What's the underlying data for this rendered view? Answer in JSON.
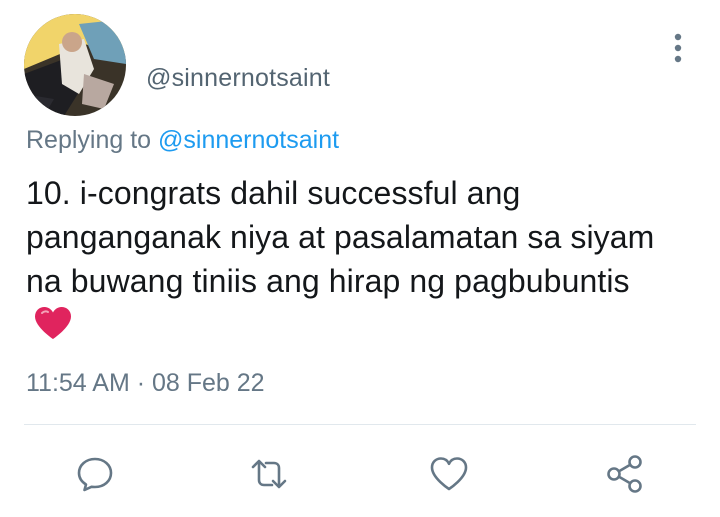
{
  "user": {
    "handle": "@sinnernotsaint"
  },
  "reply": {
    "prefix": "Replying to",
    "mention": "@sinnernotsaint"
  },
  "tweet": {
    "text": "10. i-congrats dahil successful ang panganganak niya at pasalamatan sa siyam na buwang tiniis ang hirap ng pagbubuntis",
    "emoji": "red-heart-emoji",
    "timestamp": "11:54 AM · 08 Feb 22"
  },
  "actions": [
    {
      "name": "reply",
      "icon": "comment-icon"
    },
    {
      "name": "retweet",
      "icon": "retweet-icon"
    },
    {
      "name": "like",
      "icon": "heart-icon"
    },
    {
      "name": "share",
      "icon": "share-icon"
    }
  ],
  "colors": {
    "text": "#14171a",
    "secondary": "#657786",
    "link": "#1d9bf0",
    "heart": "#e0245e"
  }
}
